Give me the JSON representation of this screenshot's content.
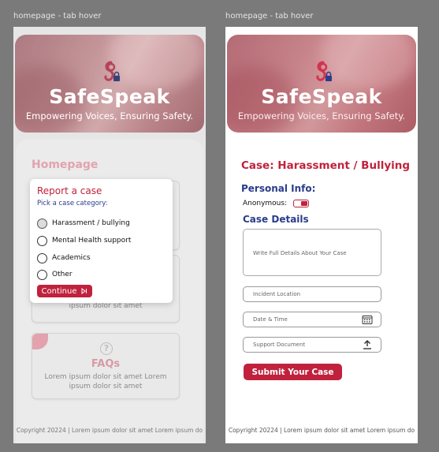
{
  "frames": {
    "left_label": "homepage - tab hover",
    "right_label": "homepage - tab hover"
  },
  "hero": {
    "brand": "SafeSpeak",
    "tagline": "Empowering Voices, Ensuring Safety.",
    "logo_icon": "safespeak-logo-icon"
  },
  "homepage": {
    "title": "Homepage",
    "card2_text": "ipsum dolor sit amet",
    "faq_title": "FAQs",
    "faq_text_1": "Lorem ipsum dolor sit amet Lorem",
    "faq_text_2": "ipsum dolor sit amet",
    "faq_icon": "question-circle-icon"
  },
  "popup": {
    "title": "Report a case",
    "subtitle": "Pick a case category:",
    "options": [
      "Harassment / bullying",
      "Mental Health support",
      "Academics",
      "Other"
    ],
    "hovered_option": "Harassment / bullying",
    "continue_label": "Continue"
  },
  "case_form": {
    "title": "Case: Harassment / Bullying",
    "personal_info": "Personal Info:",
    "anonymous_label": "Anonymous:",
    "anonymous_on": true,
    "case_details": "Case Details",
    "details_placeholder": "Write Full Details About Your Case",
    "location_placeholder": "Incident Location",
    "date_placeholder": "Date & Time",
    "document_placeholder": "Support Document",
    "submit_label": "Submit Your Case"
  },
  "footer": {
    "text": "Copyright 20224 | Lorem ipsum dolor sit amet Lorem ipsum do"
  },
  "colors": {
    "accent": "#c0223d",
    "heading_blue": "#2a3c8c",
    "muted_pink": "#e2a3ae"
  }
}
